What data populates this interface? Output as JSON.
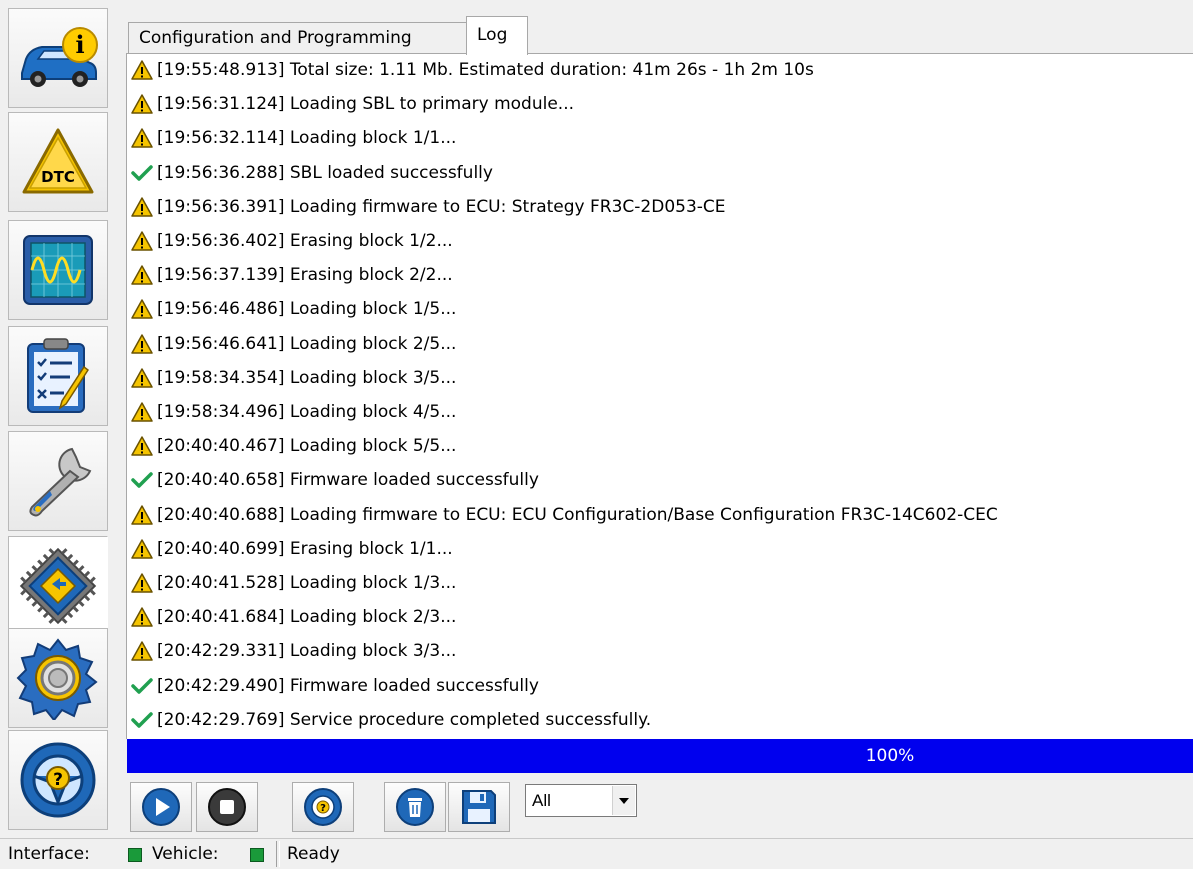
{
  "tabs": [
    {
      "label": "Configuration and Programming"
    },
    {
      "label": "Log"
    }
  ],
  "log": [
    {
      "type": "warning",
      "text": "[19:55:48.913] Total size: 1.11 Mb. Estimated duration: 41m 26s - 1h 2m 10s"
    },
    {
      "type": "warning",
      "text": "[19:56:31.124] Loading SBL to primary module..."
    },
    {
      "type": "warning",
      "text": "[19:56:32.114] Loading block 1/1..."
    },
    {
      "type": "success",
      "text": "[19:56:36.288] SBL loaded successfully"
    },
    {
      "type": "warning",
      "text": "[19:56:36.391] Loading firmware to ECU: Strategy FR3C-2D053-CE"
    },
    {
      "type": "warning",
      "text": "[19:56:36.402] Erasing block 1/2..."
    },
    {
      "type": "warning",
      "text": "[19:56:37.139] Erasing block 2/2..."
    },
    {
      "type": "warning",
      "text": "[19:56:46.486] Loading block 1/5..."
    },
    {
      "type": "warning",
      "text": "[19:56:46.641] Loading block 2/5..."
    },
    {
      "type": "warning",
      "text": "[19:58:34.354] Loading block 3/5..."
    },
    {
      "type": "warning",
      "text": "[19:58:34.496] Loading block 4/5..."
    },
    {
      "type": "warning",
      "text": "[20:40:40.467] Loading block 5/5..."
    },
    {
      "type": "success",
      "text": "[20:40:40.658] Firmware loaded successfully"
    },
    {
      "type": "warning",
      "text": "[20:40:40.688] Loading firmware to ECU: ECU Configuration/Base Configuration FR3C-14C602-CEC"
    },
    {
      "type": "warning",
      "text": "[20:40:40.699] Erasing block 1/1..."
    },
    {
      "type": "warning",
      "text": "[20:40:41.528] Loading block 1/3..."
    },
    {
      "type": "warning",
      "text": "[20:40:41.684] Loading block 2/3..."
    },
    {
      "type": "warning",
      "text": "[20:42:29.331] Loading block 3/3..."
    },
    {
      "type": "success",
      "text": "[20:42:29.490] Firmware loaded successfully"
    },
    {
      "type": "success",
      "text": "[20:42:29.769] Service procedure completed successfully."
    }
  ],
  "progress": {
    "value": 100,
    "label": "100%"
  },
  "filter": {
    "selected": "All"
  },
  "statusbar": {
    "interface_label": "Interface:",
    "vehicle_label": "Vehicle:",
    "status_text": "Ready"
  },
  "sidebar": [
    {
      "icon": "vehicle-info-icon",
      "label": "i"
    },
    {
      "icon": "dtc-icon",
      "label": "DTC"
    },
    {
      "icon": "oscilloscope-icon"
    },
    {
      "icon": "checklist-icon"
    },
    {
      "icon": "wrench-icon"
    },
    {
      "icon": "chip-programming-icon"
    },
    {
      "icon": "settings-gear-icon"
    },
    {
      "icon": "help-steering-wheel-icon",
      "label": "?"
    }
  ],
  "colors": {
    "progress": "#0000ee",
    "warning": "#f5c400",
    "success": "#20a050",
    "led": "#1a9a3a"
  }
}
